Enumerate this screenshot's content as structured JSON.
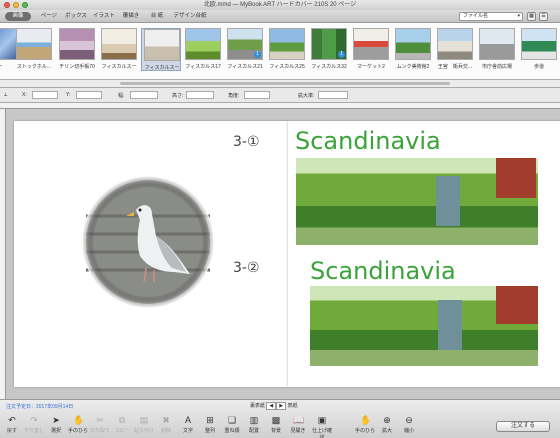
{
  "window": {
    "title": "北欧.mmd — MyBook ART ハードカバー 210S 20 ページ"
  },
  "tabs": [
    "画像",
    "ページ",
    "ボックス",
    "イラスト",
    "覆描き",
    "台 紙",
    "デザイン台紙"
  ],
  "sort": {
    "value": "ファイル名"
  },
  "thumbnails": [
    {
      "label": "ー"
    },
    {
      "label": "ストックホル..."
    },
    {
      "label": "チリン切手帳70"
    },
    {
      "label": "フィスカルスー"
    },
    {
      "label": "フィスカルスー"
    },
    {
      "label": "フィスカルス17"
    },
    {
      "label": "フィスカルス21",
      "badge": "1"
    },
    {
      "label": "フィスカルス25"
    },
    {
      "label": "フィスカルス32",
      "badge": "1"
    },
    {
      "label": "マーケット2"
    },
    {
      "label": "ムンク美術館2"
    },
    {
      "label": "王宮　衛兵交..."
    },
    {
      "label": "市庁舎前広場"
    },
    {
      "label": "歩道"
    }
  ],
  "props": {
    "x": "X:",
    "y": "Y:",
    "w": "幅:",
    "h": "高さ:",
    "angle": "角度:",
    "zoom": "拡大率:"
  },
  "page_right": {
    "item1": {
      "num": "3-①",
      "title": "Scandinavia"
    },
    "item2": {
      "num": "3-②",
      "title": "Scandinavia"
    }
  },
  "bottom": {
    "date": "注文予定日：2017年09月14日",
    "nav_left": "裏表紙",
    "nav_right": "表紙",
    "tools": [
      "戻す",
      "やり直し",
      "選択",
      "手のひら",
      "切り取り",
      "コピー",
      "貼り付け",
      "削除",
      "文字",
      "整列",
      "重ね順",
      "配置",
      "背景",
      "見開き",
      "仕上げ確認"
    ],
    "right_tools": [
      "手のひら",
      "拡大",
      "縮小"
    ],
    "order": "注文する"
  }
}
